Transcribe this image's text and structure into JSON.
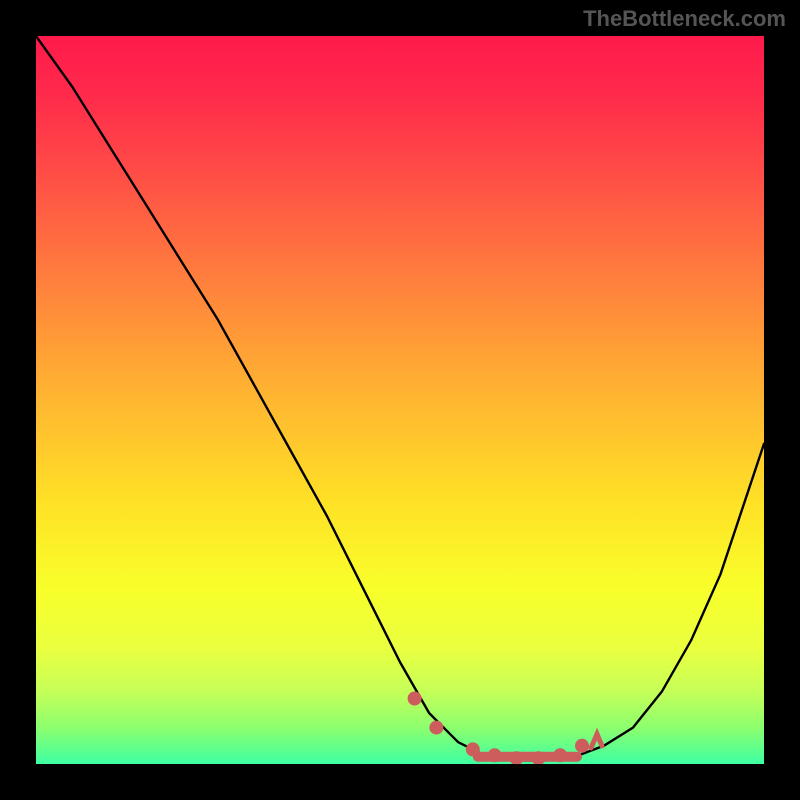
{
  "attribution": "TheBottleneck.com",
  "chart_data": {
    "type": "line",
    "title": "",
    "xlabel": "",
    "ylabel": "",
    "xlim": [
      0,
      100
    ],
    "ylim": [
      0,
      100
    ],
    "grid": false,
    "series": [
      {
        "name": "bottleneck-curve",
        "x": [
          0,
          5,
          10,
          15,
          20,
          25,
          30,
          35,
          40,
          45,
          50,
          54,
          58,
          62,
          66,
          70,
          74,
          78,
          82,
          86,
          90,
          94,
          100
        ],
        "y": [
          100,
          93,
          85,
          77,
          69,
          61,
          52,
          43,
          34,
          24,
          14,
          7,
          3,
          1,
          0.5,
          0.5,
          1,
          2.5,
          5,
          10,
          17,
          26,
          44
        ]
      }
    ],
    "markers": {
      "name": "highlight-points",
      "color": "#cd5c5c",
      "x": [
        52,
        55,
        60,
        63,
        66,
        69,
        72,
        75
      ],
      "y": [
        9,
        5,
        2,
        1.2,
        0.8,
        0.8,
        1.2,
        2.5
      ]
    },
    "gradient_stops": [
      {
        "pos": 0.0,
        "color": "#ff1a4b"
      },
      {
        "pos": 0.18,
        "color": "#ff4a47"
      },
      {
        "pos": 0.48,
        "color": "#ffb032"
      },
      {
        "pos": 0.76,
        "color": "#f8ff2a"
      },
      {
        "pos": 1.0,
        "color": "#3effa3"
      }
    ]
  }
}
